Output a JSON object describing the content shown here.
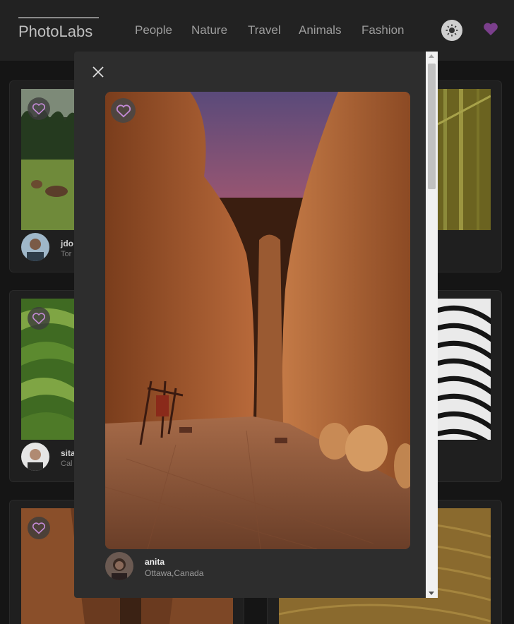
{
  "app": {
    "logo": "PhotoLabs"
  },
  "nav": {
    "items": [
      "People",
      "Nature",
      "Travel",
      "Animals",
      "Fashion"
    ]
  },
  "colors": {
    "accent": "#7b3f8c",
    "heart_outline": "#c48ad6",
    "background": "#151515",
    "topbar": "#222222",
    "modal": "#2d2d2d"
  },
  "background_cards": [
    {
      "user": "jdo",
      "location": "Tor"
    },
    {
      "user": "sita",
      "location": "Cal"
    },
    {
      "user": "",
      "location": ""
    }
  ],
  "modal": {
    "username": "anita",
    "location": "Ottawa,Canada",
    "close_icon": "close-icon",
    "favorite_icon": "heart-outline-icon"
  }
}
